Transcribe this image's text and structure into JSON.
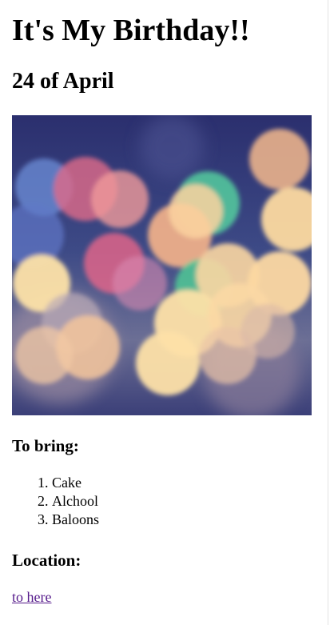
{
  "title": "It's My Birthday!!",
  "date": "24 of April",
  "image": {
    "description_icon": "bokeh-lights-photo"
  },
  "bring": {
    "heading": "To bring:",
    "items": [
      "Cake",
      "Alchool",
      "Baloons"
    ]
  },
  "location": {
    "heading": "Location:",
    "link_text": "to here"
  },
  "colors": {
    "visited_link": "#551a8b",
    "text": "#000000",
    "background": "#ffffff"
  }
}
